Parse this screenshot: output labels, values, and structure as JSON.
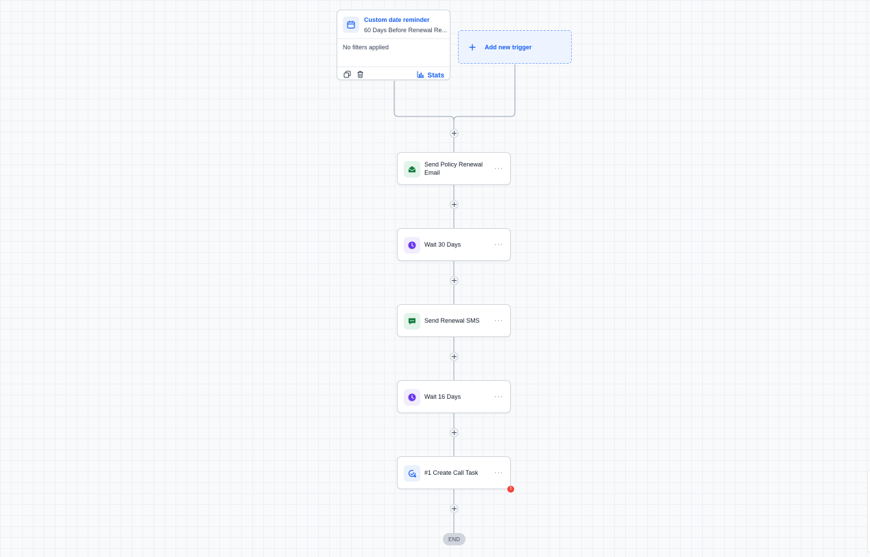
{
  "trigger": {
    "title": "Custom date reminder",
    "subtitle": "60 Days Before Renewal Re...",
    "filters": "No filters applied",
    "stats_label": "Stats",
    "icon": "calendar-icon"
  },
  "add_trigger": {
    "label": "Add new trigger"
  },
  "actions": [
    {
      "label": "Send Policy Renewal Email",
      "icon": "email-icon",
      "icon_color": "#0e7a3a",
      "icon_bg": "#e3f4ea"
    },
    {
      "label": "Wait 30 Days",
      "icon": "clock-icon",
      "icon_color": "#6938ef",
      "icon_bg": "#f1edfd"
    },
    {
      "label": "Send Renewal SMS",
      "icon": "sms-icon",
      "icon_color": "#0e7a3a",
      "icon_bg": "#e3f4ea"
    },
    {
      "label": "Wait 16 Days",
      "icon": "clock-icon",
      "icon_color": "#6938ef",
      "icon_bg": "#f1edfd"
    },
    {
      "label": "#1 Create Call Task",
      "icon": "task-icon",
      "icon_color": "#155eef",
      "icon_bg": "#eaf1fd"
    }
  ],
  "action_menu": "···",
  "error_badge": "!",
  "end_label": "END",
  "colors": {
    "accent": "#155eef",
    "error": "#f04438",
    "end_pill": "#d0d5dd"
  }
}
